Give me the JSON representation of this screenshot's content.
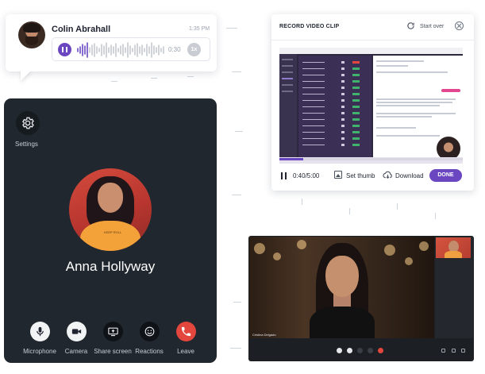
{
  "voice_message": {
    "sender": "Colin Abrahall",
    "time": "1:35 PM",
    "duration": "0:30",
    "speed": "1x"
  },
  "call": {
    "settings_label": "Settings",
    "callee_name": "Anna Hollyway",
    "callee_shirt_text": "KEEP ROLL",
    "controls": [
      {
        "label": "Microphone",
        "icon": "microphone-icon"
      },
      {
        "label": "Camera",
        "icon": "camera-icon"
      },
      {
        "label": "Share screen",
        "icon": "share-screen-icon"
      },
      {
        "label": "Reactions",
        "icon": "smiley-icon"
      },
      {
        "label": "Leave",
        "icon": "phone-hangup-icon"
      }
    ],
    "colors": {
      "panel": "#21272e",
      "leave": "#e2463d"
    }
  },
  "record_clip": {
    "title": "RECORD VIDEO CLIP",
    "start_over": "Start over",
    "time": "0:40/5:00",
    "progress": 0.13,
    "set_thumb": "Set thumb",
    "download": "Download",
    "done": "DONE",
    "accent": "#6b46c1"
  },
  "video_call": {
    "participant_label": "Cristina Delgado"
  }
}
